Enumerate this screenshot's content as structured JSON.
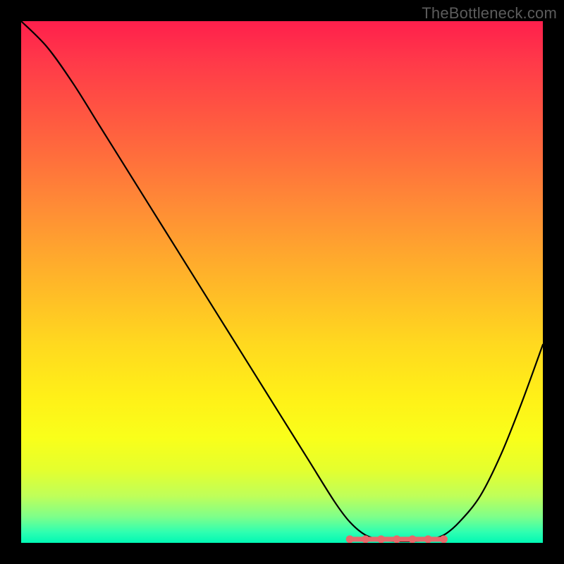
{
  "watermark": "TheBottleneck.com",
  "chart_data": {
    "type": "line",
    "title": "",
    "xlabel": "",
    "ylabel": "",
    "xlim": [
      0,
      1
    ],
    "ylim": [
      0,
      1
    ],
    "x": [
      0.0,
      0.05,
      0.1,
      0.15,
      0.2,
      0.25,
      0.3,
      0.35,
      0.4,
      0.45,
      0.5,
      0.55,
      0.6,
      0.63,
      0.66,
      0.69,
      0.72,
      0.75,
      0.78,
      0.81,
      0.84,
      0.88,
      0.92,
      0.96,
      1.0
    ],
    "values": [
      1.0,
      0.95,
      0.88,
      0.8,
      0.72,
      0.64,
      0.56,
      0.48,
      0.4,
      0.32,
      0.24,
      0.16,
      0.08,
      0.04,
      0.015,
      0.006,
      0.003,
      0.003,
      0.006,
      0.015,
      0.04,
      0.09,
      0.17,
      0.27,
      0.38
    ],
    "marker_band": {
      "color": "#e7696b",
      "center_y": 0.007,
      "x_points": [
        0.63,
        0.66,
        0.69,
        0.72,
        0.75,
        0.78,
        0.81
      ]
    },
    "background": {
      "type": "vertical-gradient",
      "stops": [
        {
          "pos": 0.0,
          "color": "#ff1f4c"
        },
        {
          "pos": 0.35,
          "color": "#ff8a36"
        },
        {
          "pos": 0.72,
          "color": "#fff018"
        },
        {
          "pos": 1.0,
          "color": "#00f8b4"
        }
      ]
    }
  }
}
